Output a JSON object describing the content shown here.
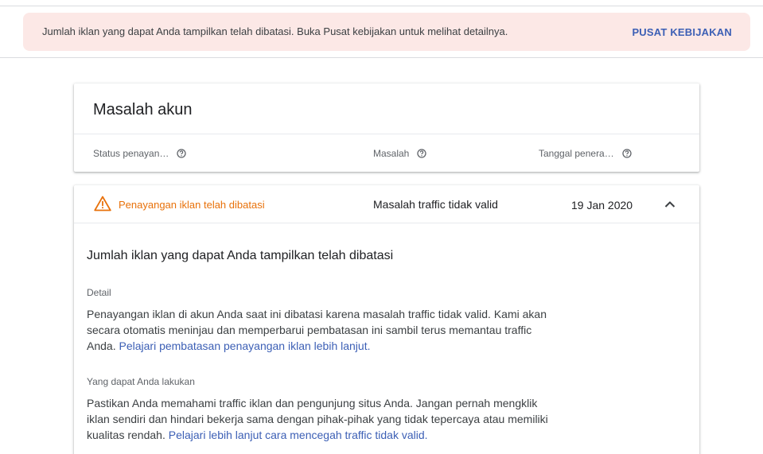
{
  "banner": {
    "message": "Jumlah iklan yang dapat Anda tampilkan telah dibatasi. Buka Pusat kebijakan untuk melihat detailnya.",
    "action_label": "PUSAT KEBIJAKAN"
  },
  "account_card": {
    "title": "Masalah akun",
    "columns": [
      {
        "label": "Status penayan…",
        "icon": "help-icon"
      },
      {
        "label": "Masalah",
        "icon": "help-icon"
      },
      {
        "label": "Tanggal penera…",
        "icon": "help-icon"
      }
    ]
  },
  "issue": {
    "status_icon": "warning-icon",
    "status_color": "#e8710a",
    "status": "Penayangan iklan telah dibatasi",
    "problem": "Masalah traffic tidak valid",
    "date": "19 Jan 2020",
    "toggle_icon": "chevron-up-icon",
    "detail_title": "Jumlah iklan yang dapat Anda tampilkan telah dibatasi",
    "detail_label": "Detail",
    "detail_text": "Penayangan iklan di akun Anda saat ini dibatasi karena masalah traffic tidak valid. Kami akan secara otomatis meninjau dan memperbarui pembatasan ini sambil terus memantau traffic Anda.",
    "detail_link": "Pelajari pembatasan penayangan iklan lebih lanjut.",
    "action_label": "Yang dapat Anda lakukan",
    "action_text": "Pastikan Anda memahami traffic iklan dan pengunjung situs Anda. Jangan pernah mengklik iklan sendiri dan hindari bekerja sama dengan pihak-pihak yang tidak tepercaya atau memiliki kualitas rendah.",
    "action_link": "Pelajari lebih lanjut cara mencegah traffic tidak valid."
  },
  "colors": {
    "banner_bg": "#fce8e6",
    "link": "#3c5fb5",
    "warning": "#e8710a"
  }
}
